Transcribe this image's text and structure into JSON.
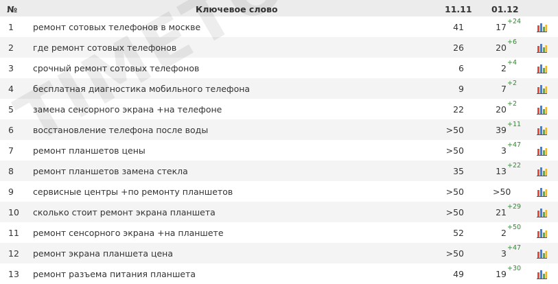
{
  "header": {
    "num": "№",
    "keyword": "Ключевое слово",
    "date1": "11.11",
    "date2": "01.12"
  },
  "rows": [
    {
      "num": "1",
      "keyword": "ремонт сотовых телефонов в москве",
      "pos1": "41",
      "pos2": "17",
      "delta": "+24"
    },
    {
      "num": "2",
      "keyword": "где ремонт сотовых телефонов",
      "pos1": "26",
      "pos2": "20",
      "delta": "+6"
    },
    {
      "num": "3",
      "keyword": "срочный ремонт сотовых телефонов",
      "pos1": "6",
      "pos2": "2",
      "delta": "+4"
    },
    {
      "num": "4",
      "keyword": "бесплатная диагностика мобильного телефона",
      "pos1": "9",
      "pos2": "7",
      "delta": "+2"
    },
    {
      "num": "5",
      "keyword": "замена сенсорного экрана +на телефоне",
      "pos1": "22",
      "pos2": "20",
      "delta": "+2"
    },
    {
      "num": "6",
      "keyword": "восстановление телефона после воды",
      "pos1": ">50",
      "pos2": "39",
      "delta": "+11"
    },
    {
      "num": "7",
      "keyword": "ремонт планшетов цены",
      "pos1": ">50",
      "pos2": "3",
      "delta": "+47"
    },
    {
      "num": "8",
      "keyword": "ремонт планшетов замена стекла",
      "pos1": "35",
      "pos2": "13",
      "delta": "+22"
    },
    {
      "num": "9",
      "keyword": "сервисные центры +по ремонту планшетов",
      "pos1": ">50",
      "pos2": ">50",
      "delta": ""
    },
    {
      "num": "10",
      "keyword": "сколько стоит ремонт экрана планшета",
      "pos1": ">50",
      "pos2": "21",
      "delta": "+29"
    },
    {
      "num": "11",
      "keyword": "ремонт сенсорного экрана +на планшете",
      "pos1": "52",
      "pos2": "2",
      "delta": "+50"
    },
    {
      "num": "12",
      "keyword": "ремонт экрана планшета цена",
      "pos1": ">50",
      "pos2": "3",
      "delta": "+47"
    },
    {
      "num": "13",
      "keyword": "ремонт разъема питания планшета",
      "pos1": "49",
      "pos2": "19",
      "delta": "+30"
    }
  ],
  "watermark": "TIMETO.TOP",
  "colors": {
    "delta": "#2e8b2e",
    "header_bg": "#ececec",
    "alt_row_bg": "#f4f4f4"
  },
  "icons": {
    "row_action": "bar-chart-icon"
  }
}
